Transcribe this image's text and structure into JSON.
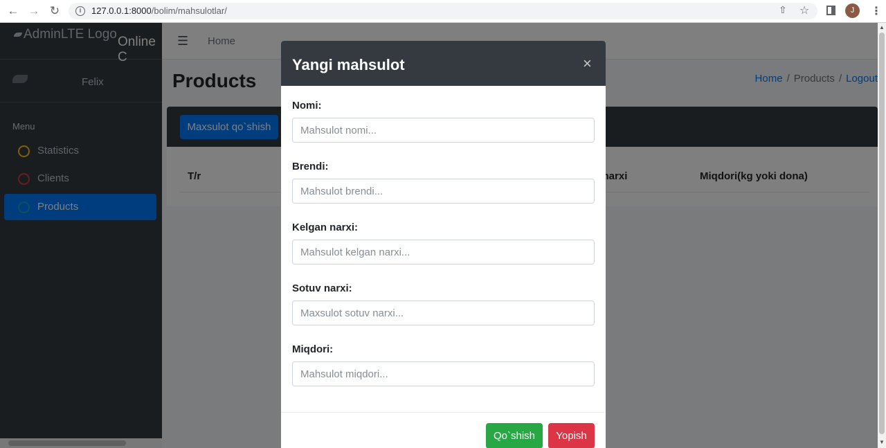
{
  "browser": {
    "url_host": "127.0.0.1:8000",
    "url_path": "/bolim/mahsulotlar/",
    "avatar_letter": "J"
  },
  "sidebar": {
    "logo_text": "AdminLTE Logo",
    "app_name": "Online C",
    "user_name": "Felix",
    "menu_header": "Menu",
    "items": [
      {
        "label": "Statistics",
        "ring_color": "#ffc107"
      },
      {
        "label": "Clients",
        "ring_color": "#dc3545"
      },
      {
        "label": "Products",
        "ring_color": "#17a2b8"
      }
    ]
  },
  "topbar": {
    "home_label": "Home"
  },
  "page": {
    "title": "Products",
    "breadcrumb": [
      "Home",
      "Products",
      "Logout"
    ],
    "add_button": "Maxsulot qo`shish",
    "table_headers": [
      "T/r",
      "v narxi",
      "Miqdori(kg yoki dona)"
    ]
  },
  "modal": {
    "title": "Yangi mahsulot",
    "fields": [
      {
        "label": "Nomi:",
        "placeholder": "Mahsulot nomi..."
      },
      {
        "label": "Brendi:",
        "placeholder": "Mahsulot brendi..."
      },
      {
        "label": "Kelgan narxi:",
        "placeholder": "Mahsulot kelgan narxi..."
      },
      {
        "label": "Sotuv narxi:",
        "placeholder": "Maxsulot sotuv narxi..."
      },
      {
        "label": "Miqdori:",
        "placeholder": "Mahsulot miqdori..."
      }
    ],
    "submit_label": "Qo`shish",
    "close_label": "Yopish"
  },
  "colors": {
    "primary": "#007bff",
    "success": "#28a745",
    "danger": "#dc3545",
    "dark": "#343a40"
  }
}
